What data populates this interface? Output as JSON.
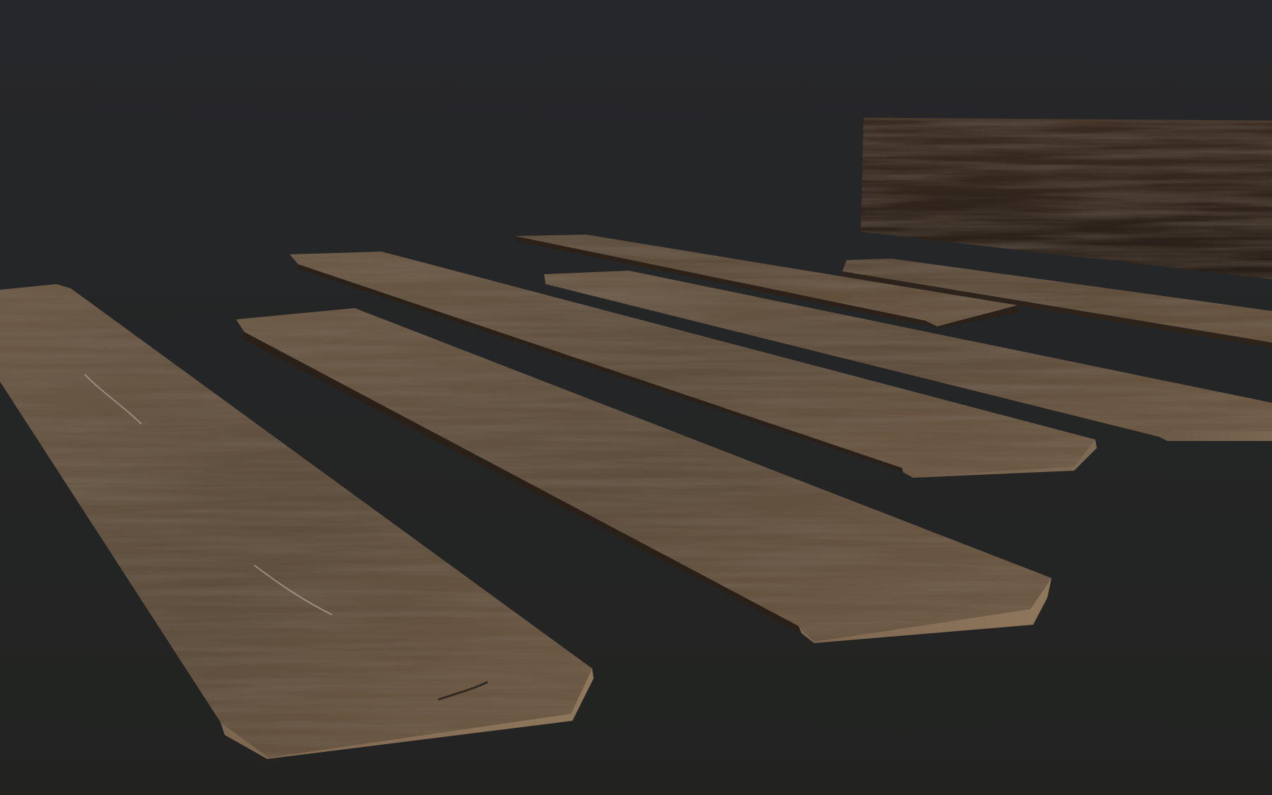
{
  "scene": {
    "subject": "wooden-planks",
    "plank_count": 7,
    "colors": {
      "background_top": "#26272a",
      "background_bottom": "#222321",
      "wood_light": "#7a6650",
      "wood_mid": "#5e4d3b",
      "wood_dark": "#3b2f25",
      "wood_edge": "#2a211a",
      "end_grain": "#8a7258",
      "beam_dark": "#2f241c"
    }
  }
}
